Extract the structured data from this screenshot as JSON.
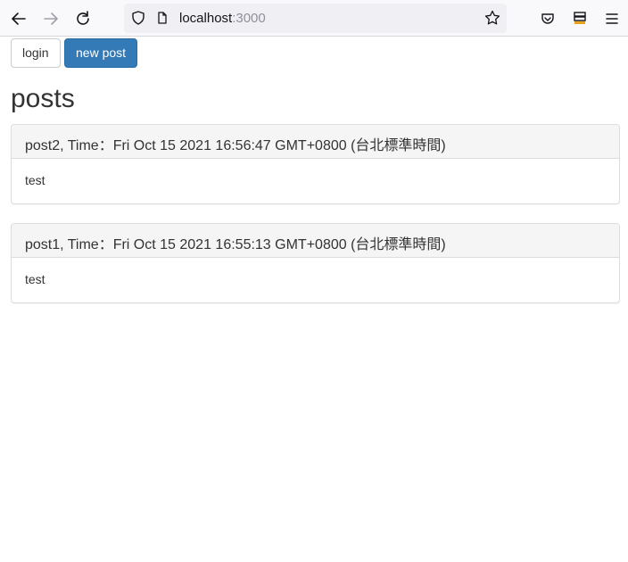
{
  "browser": {
    "url_host": "localhost",
    "url_port": ":3000"
  },
  "page": {
    "buttons": {
      "login": "login",
      "new_post": "new post"
    },
    "heading": "posts",
    "posts": [
      {
        "title": "post2, Time：Fri Oct 15 2021 16:56:47 GMT+0800 (台北標準時間)",
        "body": "test"
      },
      {
        "title": "post1, Time：Fri Oct 15 2021 16:55:13 GMT+0800 (台北標準時間)",
        "body": "test"
      }
    ]
  },
  "colors": {
    "primary": "#337ab7",
    "chrome_bg": "#f9f9fb",
    "urlbar_bg": "#f0f0f4"
  }
}
